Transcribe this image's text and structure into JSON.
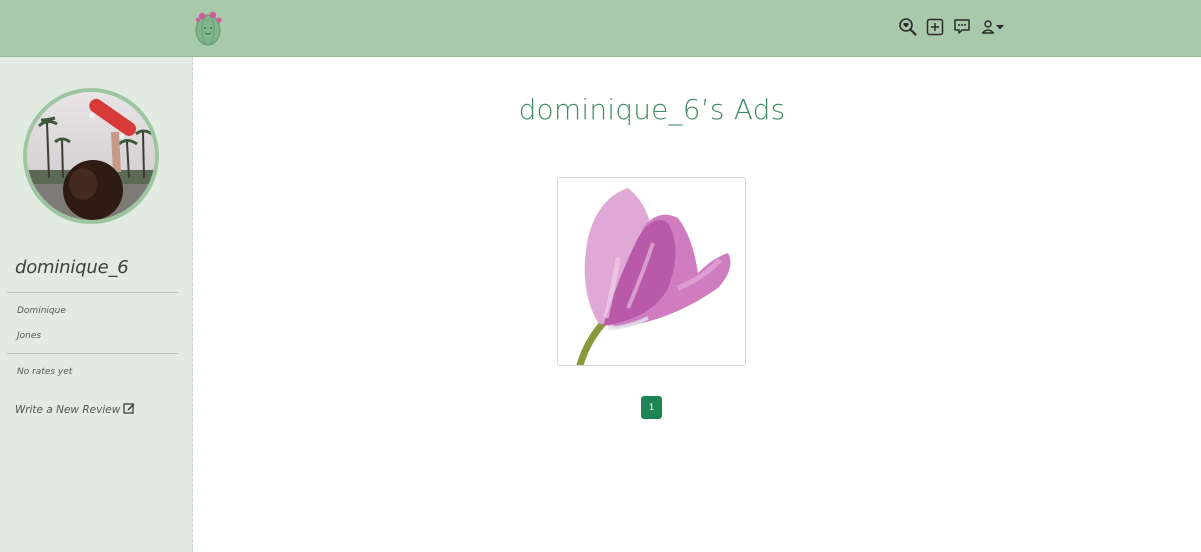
{
  "nav": {
    "icons": [
      "search-heart-icon",
      "add-square-icon",
      "chat-icon",
      "user-dropdown-icon"
    ],
    "brand_color": "#a9c9ab"
  },
  "sidebar": {
    "username": "dominique_6",
    "first_name": "Dominique",
    "last_name": "Jones",
    "rating": "No rates yet",
    "review_link": "Write a New Review"
  },
  "main": {
    "title": "dominique_6’s Ads",
    "pagination": [
      "1"
    ],
    "accent_color": "#1f8454"
  }
}
